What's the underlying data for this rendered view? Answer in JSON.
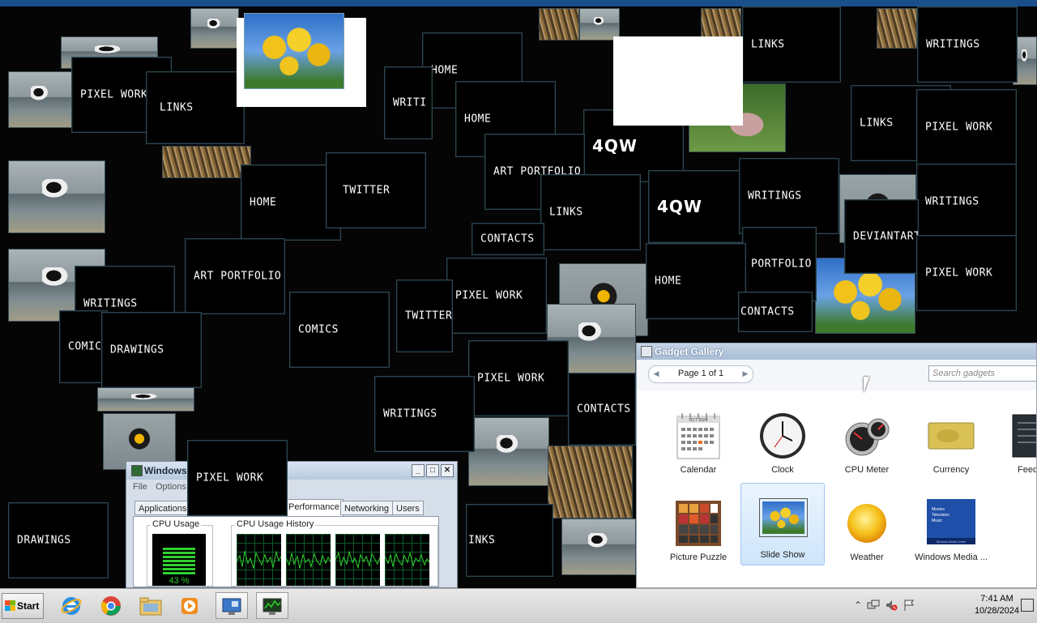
{
  "desktop": {
    "tiles": [
      "PIXEL WORK",
      "LINKS",
      "HOME",
      "WRITI",
      "HOME",
      "LINKS",
      "WRITINGS",
      "4QW",
      "LINKS",
      "PIXEL WORK",
      "HOME",
      "TWITTER",
      "ART PORTFOLIO",
      "4QW",
      "WRITINGS",
      "WRITINGS",
      "LINKS",
      "CONTACTS",
      "DEVIANTART",
      "ART PORTFOLIO",
      "PORTFOLIO",
      "HOME",
      "PIXEL WORK",
      "WRITINGS",
      "PIXEL WORK",
      "TWITTER",
      "CONTACTS",
      "COMICS",
      "COMIC",
      "DRAWINGS",
      "PIXEL WORK",
      "WRITINGS",
      "CONTACTS",
      "PIXEL WORK",
      "DRAWINGS",
      "INKS"
    ]
  },
  "taskmgr": {
    "title": "Windows",
    "menu": [
      "File",
      "Options"
    ],
    "tabs": [
      "Applications",
      "Performance",
      "Networking",
      "Users"
    ],
    "active_tab": "Performance",
    "cpu_usage_label": "CPU Usage",
    "cpu_history_label": "CPU Usage History",
    "cpu_percent": "43 %",
    "cpu_percent_value": 43,
    "min_label": "_",
    "max_label": "□",
    "close_label": "✕"
  },
  "gallery": {
    "title": "Gadget Gallery",
    "page": "Page 1 of 1",
    "prev_label": "◀",
    "next_label": "▶",
    "search_placeholder": "Search gadgets",
    "items": [
      {
        "name": "Calendar",
        "icon": "calendar-icon"
      },
      {
        "name": "Clock",
        "icon": "clock-icon"
      },
      {
        "name": "CPU Meter",
        "icon": "cpu-meter-icon"
      },
      {
        "name": "Currency",
        "icon": "currency-icon"
      },
      {
        "name": "Feed He",
        "icon": "feed-headlines-icon"
      },
      {
        "name": "Picture Puzzle",
        "icon": "picture-puzzle-icon"
      },
      {
        "name": "Slide Show",
        "icon": "slide-show-icon",
        "selected": true
      },
      {
        "name": "Weather",
        "icon": "weather-icon"
      },
      {
        "name": "Windows Media ...",
        "icon": "windows-media-icon"
      }
    ],
    "calendar_month": "OCT 2024",
    "media_text": [
      "Movies",
      "Television",
      "Music",
      "Windows Media Center"
    ]
  },
  "taskbar": {
    "start_label": "Start",
    "tray_arrow": "⌃",
    "time": "7:41 AM",
    "date": "10/28/2024"
  },
  "colors": {
    "desktop_bg": "#000000",
    "tile_border": "#2f4650",
    "cpu_green": "#2ed12e",
    "selected_gadget": "#cfe5fb"
  }
}
